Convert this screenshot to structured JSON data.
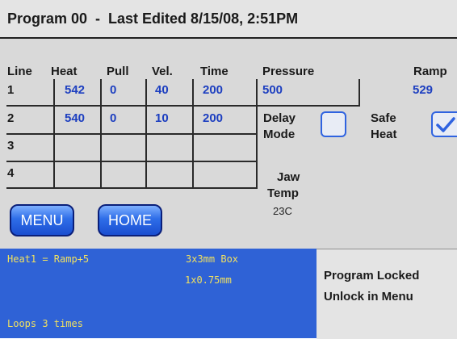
{
  "title": "Program 00  -  Last Edited 8/15/08, 2:51PM",
  "columns": {
    "line": "Line",
    "heat": "Heat",
    "pull": "Pull",
    "vel": "Vel.",
    "time": "Time",
    "pressure": "Pressure",
    "ramp": "Ramp"
  },
  "rows": [
    {
      "line": "1",
      "heat": "542",
      "pull": "0",
      "vel": "40",
      "time": "200"
    },
    {
      "line": "2",
      "heat": "540",
      "pull": "0",
      "vel": "10",
      "time": "200"
    },
    {
      "line": "3",
      "heat": "",
      "pull": "",
      "vel": "",
      "time": ""
    },
    {
      "line": "4",
      "heat": "",
      "pull": "",
      "vel": "",
      "time": ""
    }
  ],
  "pressure_value": "500",
  "ramp_value": "529",
  "delay_mode": {
    "line1": "Delay",
    "line2": "Mode",
    "checked": false
  },
  "safe_heat": {
    "line1": "Safe",
    "line2": "Heat",
    "checked": true
  },
  "jaw_temp": {
    "line1": "Jaw",
    "line2": "Temp",
    "value": "23C"
  },
  "buttons": {
    "menu": "MENU",
    "home": "HOME"
  },
  "info": {
    "heat1": "Heat1 = Ramp+5",
    "box": "3x3mm Box",
    "size": "1x0.75mm",
    "loops": "Loops 3 times"
  },
  "lock": {
    "line1": "Program Locked",
    "line2": "Unlock in Menu"
  },
  "colors": {
    "value_blue": "#1d3fc0",
    "panel_blue": "#2f62d6",
    "panel_text": "#f0e060",
    "checkbox_blue": "#2f63e0"
  }
}
